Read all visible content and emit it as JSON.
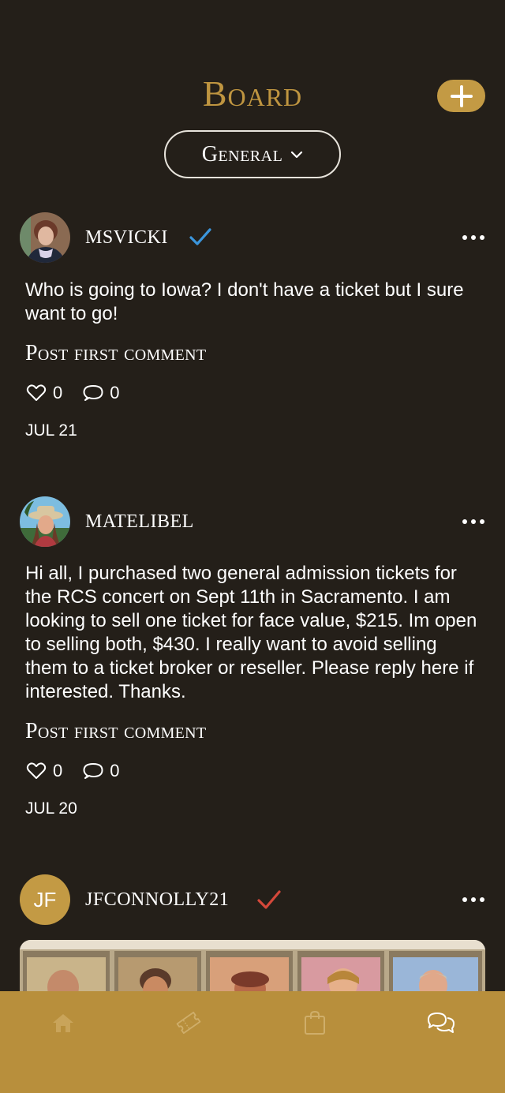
{
  "header": {
    "title": "Board",
    "filter_label": "General",
    "add_icon": "plus-icon",
    "filter_icon": "chevron-down-icon"
  },
  "posts": [
    {
      "username": "MSVICKI",
      "verified": true,
      "verify_color": "#3b95db",
      "text": "Who is going to Iowa? I don't have a ticket but I sure want to go!",
      "comment_cta": "Post first comment",
      "likes": "0",
      "comments": "0",
      "date": "JUL 21"
    },
    {
      "username": "MATELIBEL",
      "verified": false,
      "text": "Hi all, I purchased two general admission tickets for the RCS concert on Sept 11th in Sacramento. I am looking to sell one ticket for face value, $215. Im open to selling both, $430. I really want to avoid selling them to a ticket broker or reseller. Please reply here if interested.  Thanks.",
      "comment_cta": "Post first comment",
      "likes": "0",
      "comments": "0",
      "date": "JUL 20"
    },
    {
      "avatar_initials": "JF",
      "username": "JFCONNOLLY21",
      "verified": true,
      "verify_color": "#d4483a"
    }
  ],
  "nav": {
    "items": [
      "home-icon",
      "ticket-icon",
      "shopping-bag-icon",
      "chat-icon"
    ]
  },
  "colors": {
    "background": "#241f19",
    "accent": "#c39a44",
    "nav_bar": "#b88f3c"
  }
}
